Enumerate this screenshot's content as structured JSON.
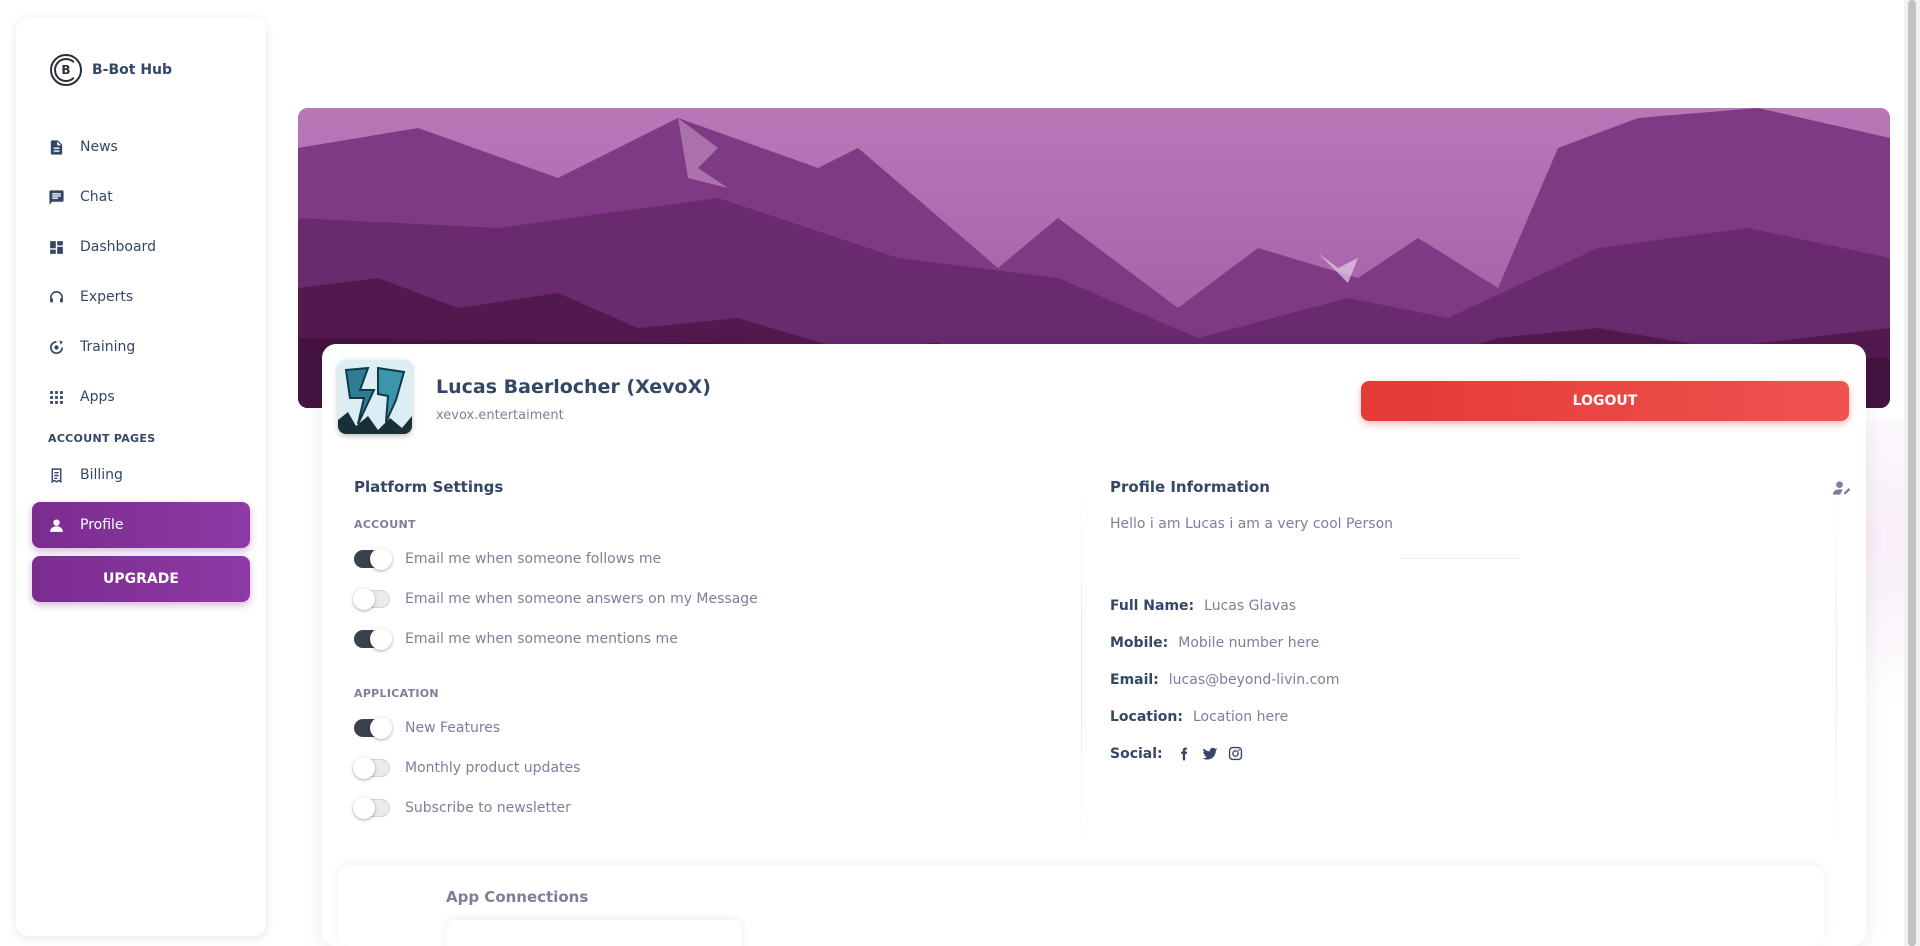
{
  "brand": {
    "name": "B-Bot Hub",
    "logo_icon": "b-bot-logo-icon"
  },
  "sidebar": {
    "items": [
      {
        "label": "News",
        "icon": "news-icon"
      },
      {
        "label": "Chat",
        "icon": "chat-icon"
      },
      {
        "label": "Dashboard",
        "icon": "dashboard-icon"
      },
      {
        "label": "Experts",
        "icon": "headset-icon"
      },
      {
        "label": "Training",
        "icon": "training-icon"
      },
      {
        "label": "Apps",
        "icon": "apps-grid-icon"
      }
    ],
    "section_label": "ACCOUNT PAGES",
    "account_items": [
      {
        "label": "Billing",
        "icon": "receipt-icon"
      },
      {
        "label": "Profile",
        "icon": "person-icon",
        "active": true
      }
    ],
    "upgrade_label": "UPGRADE"
  },
  "profile": {
    "name": "Lucas Baerlocher (XevoX)",
    "handle": "xevox.entertaiment",
    "logout_label": "LOGOUT"
  },
  "platform_settings": {
    "title": "Platform Settings",
    "account_label": "ACCOUNT",
    "account_toggles": [
      {
        "label": "Email me when someone follows me",
        "on": true
      },
      {
        "label": "Email me when someone answers on my Message",
        "on": false
      },
      {
        "label": "Email me when someone mentions me",
        "on": true
      }
    ],
    "application_label": "APPLICATION",
    "application_toggles": [
      {
        "label": "New Features",
        "on": true
      },
      {
        "label": "Monthly product updates",
        "on": false
      },
      {
        "label": "Subscribe to newsletter",
        "on": false
      }
    ]
  },
  "profile_information": {
    "title": "Profile Information",
    "bio": "Hello i am Lucas i am a very cool Person",
    "full_name_label": "Full Name:",
    "full_name": "Lucas Glavas",
    "mobile_label": "Mobile:",
    "mobile": "Mobile number here",
    "email_label": "Email:",
    "email": "lucas@beyond-livin.com",
    "location_label": "Location:",
    "location": "Location here",
    "social_label": "Social:",
    "social_icons": [
      "facebook-icon",
      "twitter-icon",
      "instagram-icon"
    ]
  },
  "app_connections": {
    "title": "App Connections"
  },
  "colors": {
    "accent_purple": "#7b2c8f",
    "logout_red": "#e53935",
    "text_dark": "#344767",
    "text_muted": "#7b809a"
  }
}
